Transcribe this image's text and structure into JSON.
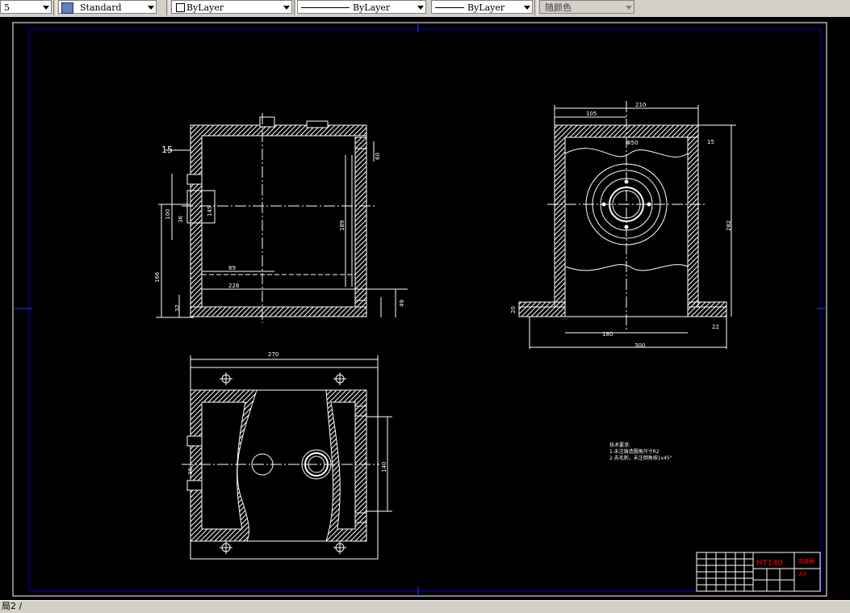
{
  "toolbar": {
    "leading_value": "5",
    "text_style": "Standard",
    "layer_color": "ByLayer",
    "linetype": "ByLayer",
    "lineweight": "ByLayer",
    "plot_style": "随颜色"
  },
  "drawing": {
    "dims_front": {
      "d15": "15",
      "d100": "100",
      "d36": "36",
      "d145": "145",
      "d166": "166",
      "d89": "89",
      "d228": "228",
      "d32": "32",
      "d49": "49",
      "d189": "189",
      "d60": "60"
    },
    "dims_side": {
      "d210": "210",
      "d105": "105",
      "dphi50": "Φ50",
      "d15": "15",
      "d282": "282",
      "d20": "20",
      "d180": "180",
      "d300": "300",
      "d22": "22"
    },
    "dims_top": {
      "d270": "270",
      "d140": "140",
      "d36": "36"
    },
    "notes_title": "技术要求:",
    "notes": [
      "1.未注铸造圆角尺寸R2",
      "2.去毛刺，未注倒角按1x45°"
    ],
    "title_block": {
      "material": "HT140",
      "name": "减速器",
      "sheet": "A3"
    }
  },
  "statusbar": {
    "layout_tab": "局2 /"
  },
  "colors": {
    "background": "#000000",
    "linework": "#ffffff",
    "frame": "#0000cc",
    "cursor": "#3333ff",
    "material": "#ff0000",
    "toolbar": "#d4d0c8"
  }
}
